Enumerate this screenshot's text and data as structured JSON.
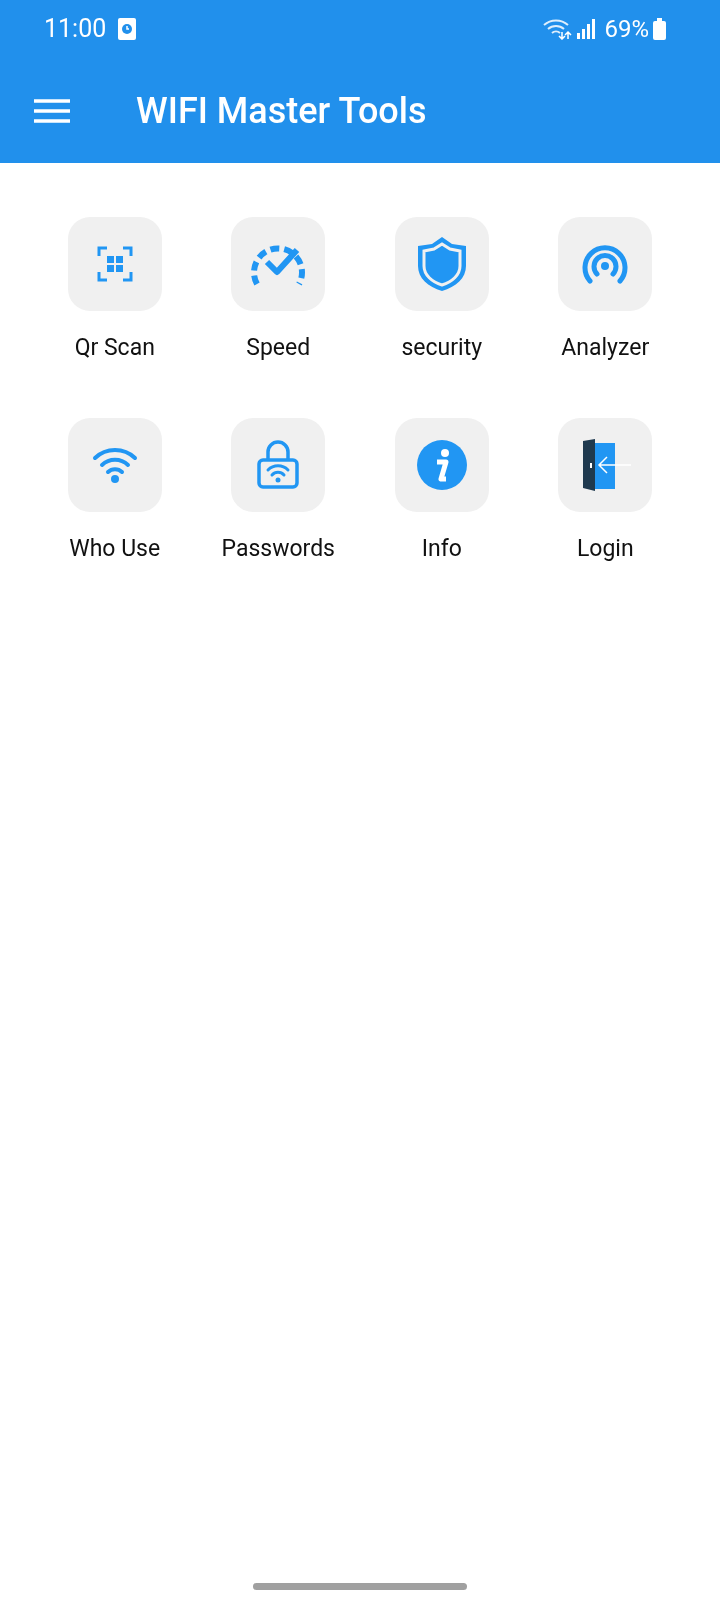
{
  "status_bar": {
    "time": "11:00",
    "battery": "69%"
  },
  "app_bar": {
    "title": "WIFI Master Tools"
  },
  "tools": [
    {
      "label": "Qr Scan",
      "kind": "qr"
    },
    {
      "label": "Speed",
      "kind": "speed"
    },
    {
      "label": "security",
      "kind": "shield"
    },
    {
      "label": "Analyzer",
      "kind": "signal"
    },
    {
      "label": "Who Use",
      "kind": "wifi"
    },
    {
      "label": "Passwords",
      "kind": "lock"
    },
    {
      "label": "Info",
      "kind": "info"
    },
    {
      "label": "Login",
      "kind": "door"
    }
  ]
}
